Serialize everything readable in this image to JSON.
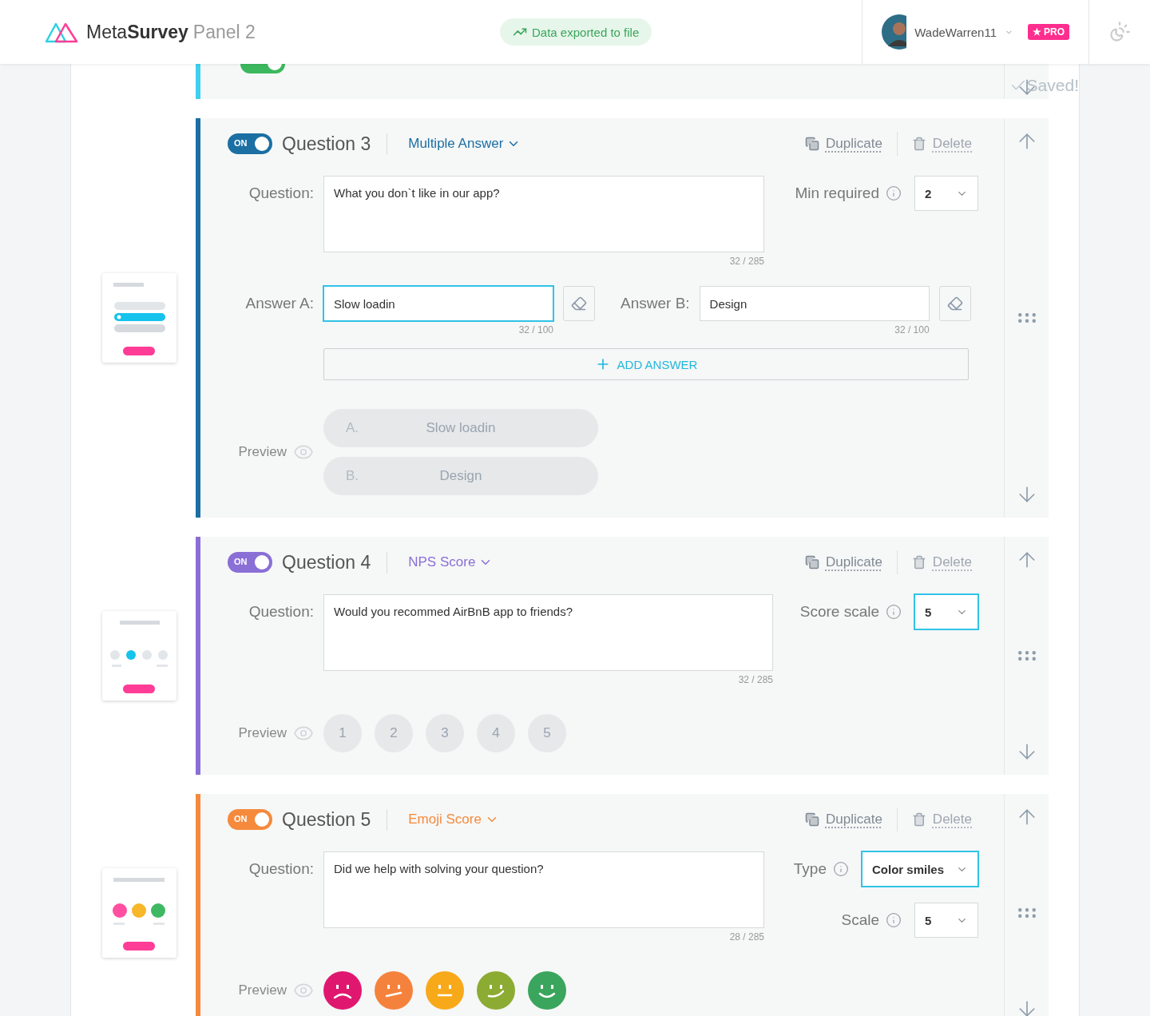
{
  "header": {
    "logo_light": "Meta",
    "logo_bold": "Survey",
    "logo_suffix": "Panel 2",
    "notice": "Data exported to file",
    "user_name": "WadeWarren11",
    "badge_star": "★",
    "badge": "PRO"
  },
  "saved": "Saved!",
  "previous": {
    "on": true
  },
  "questions": [
    {
      "kind": "multiple",
      "title": "Question 3",
      "on": true,
      "on_label": "ON",
      "color": "#1b6fa3",
      "type": "Multiple Answer",
      "duplicate": "Duplicate",
      "delete": "Delete",
      "question_label": "Question:",
      "question": "What you don`t like in our app?",
      "counter": "32 / 285",
      "settings": [
        {
          "label": "Min required",
          "value": "2",
          "focused": false
        }
      ],
      "answers": [
        {
          "label": "Answer A:",
          "value": "Slow loadin",
          "counter": "32 / 100",
          "focused": true
        },
        {
          "label": "Answer B:",
          "value": "Design",
          "counter": "32 / 100",
          "focused": false
        }
      ],
      "add_answer": "ADD ANSWER",
      "preview_label": "Preview",
      "preview": [
        {
          "letter": "A.",
          "text": "Slow loadin"
        },
        {
          "letter": "B.",
          "text": "Design"
        }
      ]
    },
    {
      "kind": "nps",
      "title": "Question 4",
      "on": true,
      "on_label": "ON",
      "color": "#8a6fd6",
      "type": "NPS Score",
      "duplicate": "Duplicate",
      "delete": "Delete",
      "question_label": "Question:",
      "question": "Would you recommed AirBnB app to friends?",
      "counter": "32 / 285",
      "settings": [
        {
          "label": "Score scale",
          "value": "5",
          "focused": true
        }
      ],
      "preview_label": "Preview",
      "preview": [
        {
          "text": "1"
        },
        {
          "text": "2"
        },
        {
          "text": "3"
        },
        {
          "text": "4"
        },
        {
          "text": "5"
        }
      ]
    },
    {
      "kind": "emoji",
      "title": "Question 5",
      "on": true,
      "on_label": "ON",
      "color": "#f58a3c",
      "type": "Emoji Score",
      "duplicate": "Duplicate",
      "delete": "Delete",
      "question_label": "Question:",
      "question": "Did we help with solving your question?",
      "counter": "28 / 285",
      "settings": [
        {
          "label": "Type",
          "value": "Color smiles",
          "focused": true
        },
        {
          "label": "Scale",
          "value": "5",
          "focused": false
        }
      ],
      "preview_label": "Preview",
      "preview": [
        {
          "kind": "sad",
          "color": "#e0176f"
        },
        {
          "kind": "skeptic",
          "color": "#f5823c"
        },
        {
          "kind": "neutral",
          "color": "#f8a91a"
        },
        {
          "kind": "smirk",
          "color": "#8cab33"
        },
        {
          "kind": "happy",
          "color": "#3aa55c"
        }
      ]
    }
  ]
}
